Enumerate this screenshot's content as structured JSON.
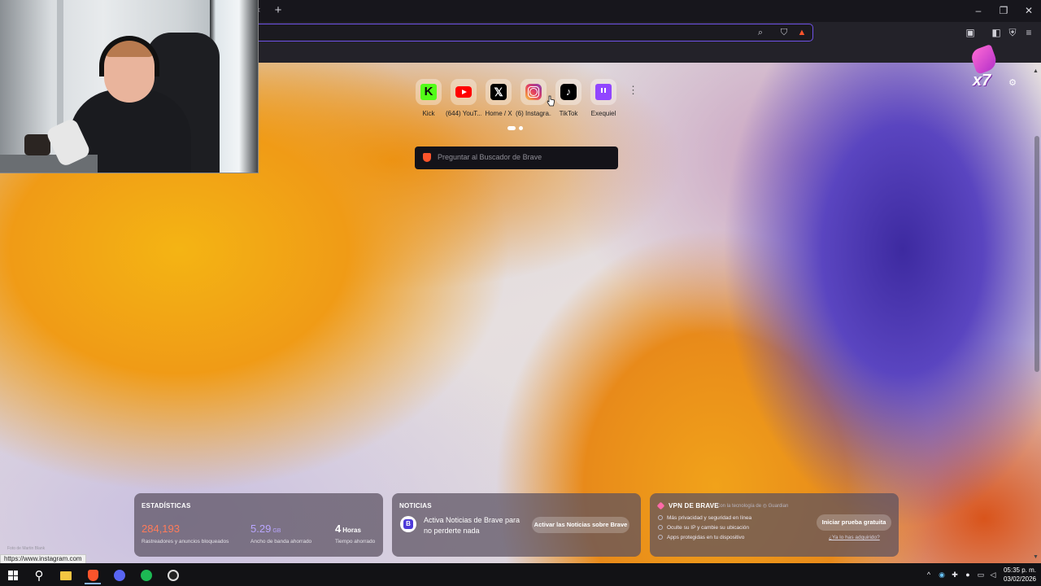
{
  "browser": {
    "new_tab_symbol": "+",
    "tab_close_symbol": "×",
    "window_controls": [
      "–",
      "❐",
      "✕"
    ],
    "accent_color": "#6f52e8"
  },
  "shortcuts": [
    {
      "label": "Kick",
      "icon": "kick-icon",
      "glyph": "K"
    },
    {
      "label": "(644) YouT...",
      "icon": "youtube-icon",
      "glyph": ""
    },
    {
      "label": "Home / X",
      "icon": "x-icon",
      "glyph": "𝕏"
    },
    {
      "label": "(6) Instagra...",
      "icon": "instagram-icon",
      "glyph": ""
    },
    {
      "label": "TikTok",
      "icon": "tiktok-icon",
      "glyph": "♪"
    },
    {
      "label": "Exequiel",
      "icon": "twitch-icon",
      "glyph": ""
    }
  ],
  "search": {
    "placeholder": "Preguntar al Buscador de Brave"
  },
  "combo_badge": "x7",
  "widgets": {
    "stats": {
      "title": "ESTADÍSTICAS",
      "trackers_value": "284,193",
      "trackers_caption": "Rastreadores y anuncios bloqueados",
      "bandwidth_value": "5.29",
      "bandwidth_unit": "GB",
      "bandwidth_caption": "Ancho de banda ahorrado",
      "time_value": "4",
      "time_unit": "Horas",
      "time_caption": "Tiempo ahorrado",
      "trackers_color": "#ff7b5a",
      "bandwidth_color": "#b9a6ff"
    },
    "news": {
      "title": "NOTICIAS",
      "text": "Activa Noticias de Brave para no perderte nada",
      "button": "Activar las Noticias sobre Brave"
    },
    "vpn": {
      "title": "VPN DE BRAVE",
      "powered_by": "Con la tecnología de ◎ Guardian",
      "items": [
        "Más privacidad y seguridad en línea",
        "Oculte su IP y cambie su ubicación",
        "Apps protegidas en tu dispositivo"
      ],
      "button": "Iniciar prueba gratuita",
      "link": "¿Ya lo has adquirido?"
    }
  },
  "photo_credit": "Foto de Martin Blank",
  "status_url": "https://www.instagram.com",
  "clock": {
    "time": "05:35 p. m.",
    "date": "03/02/2026"
  }
}
